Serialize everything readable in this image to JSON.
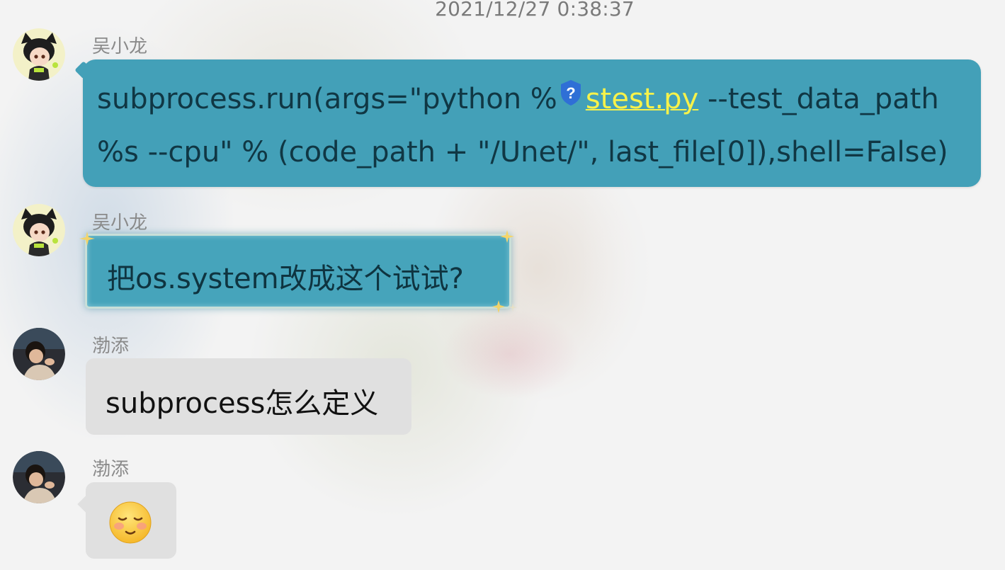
{
  "chat": {
    "timestamp": "2021/12/27 0:38:37",
    "messages": [
      {
        "sender": "吴小龙",
        "avatar": "anime-cat-girl-avatar",
        "code_prefix": "subprocess.run(args=\"python %",
        "link_text": "stest.py",
        "code_suffix": " --test_data_path",
        "code_line2": "%s --cpu\" % (code_path + \"/Unet/\", last_file[0]),shell=False)"
      },
      {
        "sender": "吴小龙",
        "avatar": "anime-cat-girl-avatar",
        "text": "把os.system改成这个试试?"
      },
      {
        "sender": "渤添",
        "avatar": "child-photo-avatar",
        "text": "subprocess怎么定义"
      },
      {
        "sender": "渤添",
        "avatar": "child-photo-avatar",
        "emoji": "blushing-face-emoji"
      }
    ]
  },
  "colors": {
    "teal_bubble": "#43a0b8",
    "link_yellow": "#f7f24a",
    "gray_bubble": "#e0e0e0"
  }
}
